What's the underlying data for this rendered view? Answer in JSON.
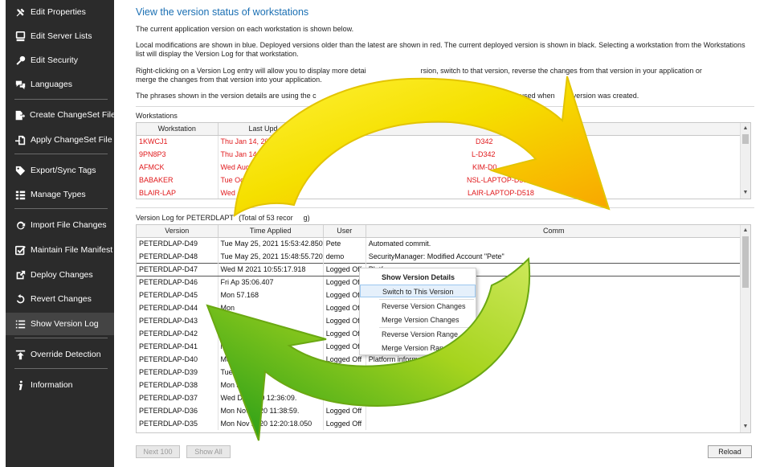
{
  "sidebar": {
    "items": [
      {
        "label": "Edit Properties",
        "icon": "tools-icon"
      },
      {
        "label": "Edit Server Lists",
        "icon": "server-list-icon"
      },
      {
        "label": "Edit Security",
        "icon": "key-icon"
      },
      {
        "label": "Languages",
        "icon": "chat-bubbles-icon"
      },
      {
        "label": "Create ChangeSet File",
        "icon": "export-file-icon"
      },
      {
        "label": "Apply ChangeSet File",
        "icon": "import-file-icon"
      },
      {
        "label": "Export/Sync Tags",
        "icon": "tag-icon"
      },
      {
        "label": "Manage Types",
        "icon": "type-list-icon"
      },
      {
        "label": "Import File Changes",
        "icon": "refresh-icon"
      },
      {
        "label": "Maintain File Manifest",
        "icon": "checkbox-icon"
      },
      {
        "label": "Deploy Changes",
        "icon": "external-link-icon"
      },
      {
        "label": "Revert Changes",
        "icon": "undo-icon"
      },
      {
        "label": "Show Version Log",
        "icon": "list-icon"
      },
      {
        "label": "Override Detection",
        "icon": "upload-icon"
      },
      {
        "label": "Information",
        "icon": "info-icon"
      }
    ],
    "active": "Show Version Log"
  },
  "main": {
    "title": "View the version status of workstations",
    "intro": "The current application version on each workstation is shown below.",
    "legend_text": "Local modifications are shown in blue. Deployed versions older than the latest are shown in red. The current deployed version is shown in black. Selecting a workstation from the Workstations list will display the Version Log for that workstation.",
    "rightclick_text_a": "Right-clicking on a Version Log entry will allow you to display more detai",
    "rightclick_text_b": "rsion, switch to that version, reve",
    "rightclick_text_c": "rse the changes from that version in your application or",
    "rightclick_text_line2": "merge the changes from that version into your application.",
    "phrases_text_a": "The phrases shown in the version details are using the c",
    "phrases_text_b": "tions used when",
    "phrases_text_c": "version was created."
  },
  "workstations": {
    "label": "Workstations",
    "columns": [
      "Workstation",
      "Last Upd"
    ],
    "rows": [
      {
        "name": "1KWCJ1",
        "updated": "Thu Jan 14, 2021",
        "extra": "D342"
      },
      {
        "name": "9PN8P3",
        "updated": "Thu Jan 14, 2",
        "extra": "L-D342"
      },
      {
        "name": "AFMCK",
        "updated": "Wed Aug",
        "extra": "KIM-D0"
      },
      {
        "name": "BABAKER",
        "updated": "Tue Oc",
        "extra": "NSL-LAPTOP-D356"
      },
      {
        "name": "BLAIR-LAP",
        "updated": "Wed",
        "extra": "LAIR-LAPTOP-D518"
      }
    ]
  },
  "version_log": {
    "label": "Version Log for PETERDLAPT",
    "label_tail": "(Total of 53 recor",
    "label_end": "g)",
    "columns": [
      "Version",
      "Time Applied",
      "User",
      "Comm"
    ],
    "rows": [
      {
        "version": "PETERDLAP-D49",
        "time": "Tue May 25, 2021 15:53:42.850",
        "user": "Pete",
        "comment": "Automated commit."
      },
      {
        "version": "PETERDLAP-D48",
        "time": "Tue May 25, 2021 15:48:55.720",
        "user": "demo",
        "comment": "SecurityManager: Modified Account \"Pete\""
      },
      {
        "version": "PETERDLAP-D47",
        "time": "Wed M   2021 10:55:17.918",
        "user": "Logged Off",
        "comment": "Platf"
      },
      {
        "version": "PETERDLAP-D46",
        "time": "Fri Ap   35:06.407",
        "user": "Logged Off",
        "comment": ""
      },
      {
        "version": "PETERDLAP-D45",
        "time": "Mon   57.168",
        "user": "Logged Off",
        "comment": ""
      },
      {
        "version": "PETERDLAP-D44",
        "time": "Mon",
        "user": "Logged Off",
        "comment": ""
      },
      {
        "version": "PETERDLAP-D43",
        "time": "Fri M",
        "user": "Logged Off",
        "comment": ""
      },
      {
        "version": "PETERDLAP-D42",
        "time": "Mon",
        "user": "Logged Off",
        "comment": ""
      },
      {
        "version": "PETERDLAP-D41",
        "time": "Mon   695",
        "user": "Logged Off",
        "comment": ""
      },
      {
        "version": "PETERDLAP-D40",
        "time": "Mon",
        "user": "Logged Off",
        "comment": "Platform information changed"
      },
      {
        "version": "PETERDLAP-D39",
        "time": "Tue Ja",
        "user": "Logged Off",
        "comment": "Platform information chang"
      },
      {
        "version": "PETERDLAP-D38",
        "time": "Mon Ja",
        "user": "Logged Off",
        "comment": ""
      },
      {
        "version": "PETERDLAP-D37",
        "time": "Wed De   2020 12:36:09.",
        "user": "Logged Off",
        "comment": ""
      },
      {
        "version": "PETERDLAP-D36",
        "time": "Mon Nov   2020 11:38:59.",
        "user": "Logged Off",
        "comment": ""
      },
      {
        "version": "PETERDLAP-D35",
        "time": "Mon Nov   2020 12:20:18.050",
        "user": "Logged Off",
        "comment": ""
      }
    ]
  },
  "context_menu": {
    "items": [
      "Show Version Details",
      "Switch to This Version",
      "Reverse Version Changes",
      "Merge Version Changes",
      "Reverse Version Range",
      "Merge Version Range"
    ]
  },
  "buttons": {
    "next": "Next 100",
    "show_all": "Show All",
    "reload": "Reload"
  },
  "overlay": {
    "icon": "sync-arrows-icon",
    "colors": {
      "yellow": "#f5e000",
      "orange": "#f9a400",
      "green_dark": "#1f9a17",
      "green_light": "#a6d41e"
    }
  }
}
